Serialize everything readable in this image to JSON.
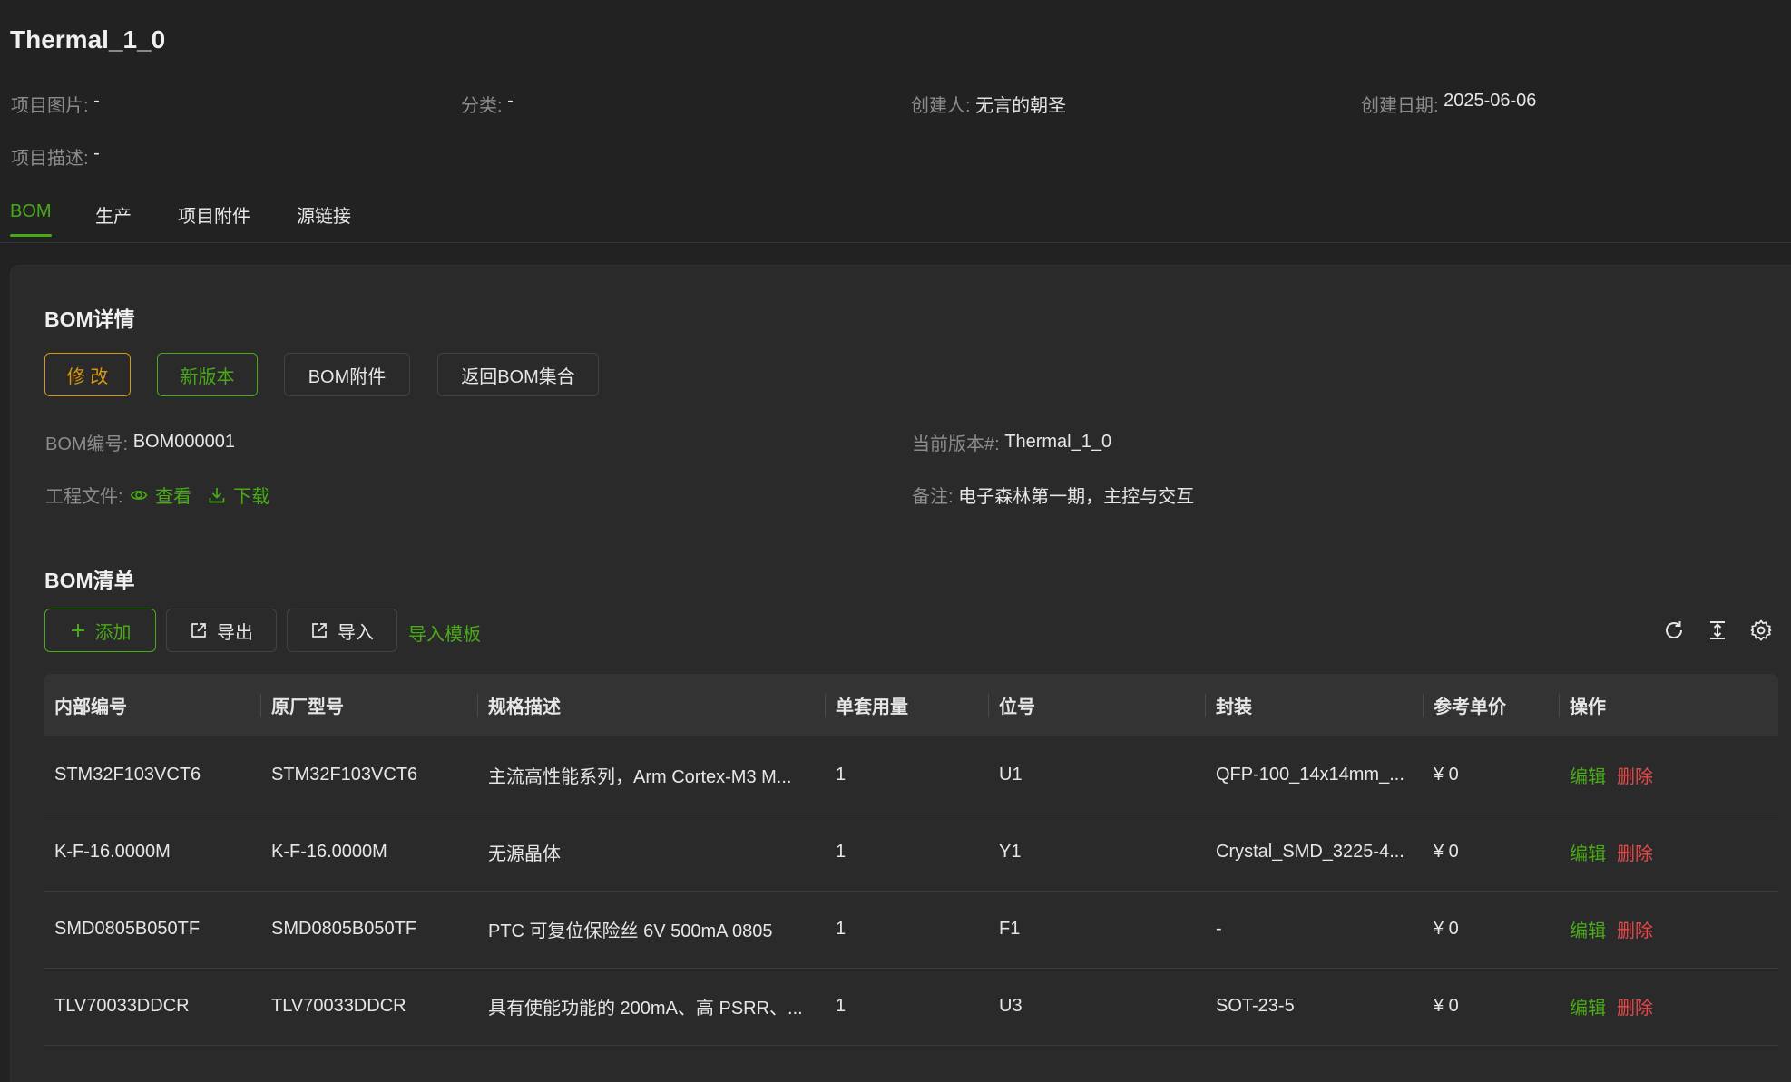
{
  "project": {
    "title": "Thermal_1_0",
    "meta": [
      {
        "label": "项目图片:",
        "value": "-"
      },
      {
        "label": "分类:",
        "value": "-"
      },
      {
        "label": "创建人:",
        "value": "无言的朝圣"
      },
      {
        "label": "创建日期:",
        "value": "2025-06-06"
      }
    ],
    "description": {
      "label": "项目描述:",
      "value": "-"
    }
  },
  "tabs": [
    {
      "label": "BOM",
      "active": true
    },
    {
      "label": "生产",
      "active": false
    },
    {
      "label": "项目附件",
      "active": false
    },
    {
      "label": "源链接",
      "active": false
    }
  ],
  "bom_detail": {
    "title": "BOM详情",
    "buttons": {
      "edit": "修 改",
      "new_version": "新版本",
      "attachments": "BOM附件",
      "back": "返回BOM集合"
    },
    "bom_no": {
      "label": "BOM编号:",
      "value": "BOM000001"
    },
    "current_version": {
      "label": "当前版本#:",
      "value": "Thermal_1_0"
    },
    "project_file": {
      "label": "工程文件:",
      "view": "查看",
      "download": "下载"
    },
    "remark": {
      "label": "备注:",
      "value": "电子森林第一期，主控与交互"
    }
  },
  "bom_list": {
    "title": "BOM清单",
    "buttons": {
      "add": "添加",
      "export": "导出",
      "import": "导入",
      "template": "导入模板"
    },
    "tools": [
      "refresh-icon",
      "column-height-icon",
      "setting-icon"
    ],
    "columns": [
      "内部编号",
      "原厂型号",
      "规格描述",
      "单套用量",
      "位号",
      "封装",
      "参考单价",
      "操作"
    ],
    "actions": {
      "edit": "编辑",
      "delete": "删除"
    },
    "rows": [
      {
        "code": "STM32F103VCT6",
        "model": "STM32F103VCT6",
        "desc": "主流高性能系列，Arm Cortex-M3 M...",
        "qty": "1",
        "ref": "U1",
        "pkg": "QFP-100_14x14mm_...",
        "price": "¥ 0"
      },
      {
        "code": "K-F-16.0000M",
        "model": "K-F-16.0000M",
        "desc": "无源晶体",
        "qty": "1",
        "ref": "Y1",
        "pkg": "Crystal_SMD_3225-4...",
        "price": "¥ 0"
      },
      {
        "code": "SMD0805B050TF",
        "model": "SMD0805B050TF",
        "desc": "PTC 可复位保险丝 6V 500mA 0805",
        "qty": "1",
        "ref": "F1",
        "pkg": "-",
        "price": "¥ 0"
      },
      {
        "code": "TLV70033DDCR",
        "model": "TLV70033DDCR",
        "desc": "具有使能功能的 200mA、高 PSRR、...",
        "qty": "1",
        "ref": "U3",
        "pkg": "SOT-23-5",
        "price": "¥ 0"
      }
    ]
  },
  "colors": {
    "primary": "#49aa19",
    "warning": "#d89614",
    "danger": "#e84749",
    "background": "#222222"
  }
}
